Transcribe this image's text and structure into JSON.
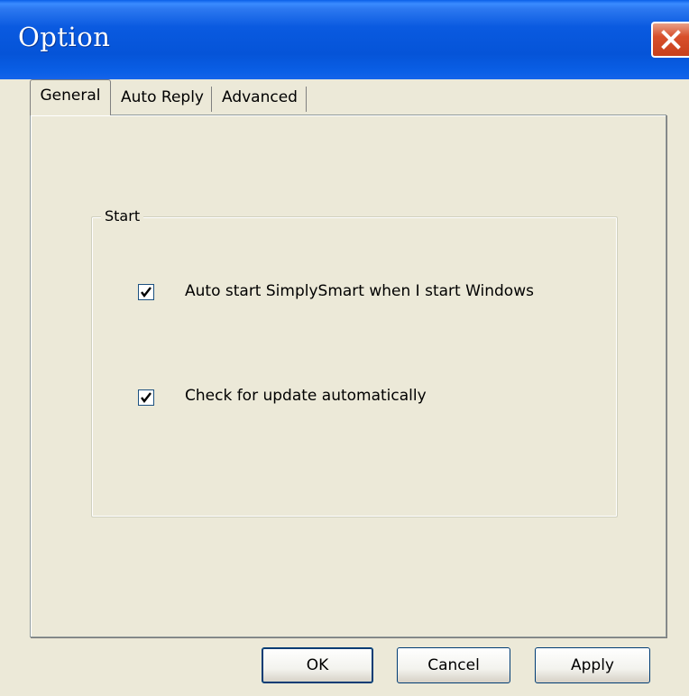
{
  "window": {
    "title": "Option",
    "close_icon": "close-icon"
  },
  "tabs": [
    {
      "label": "General",
      "selected": true
    },
    {
      "label": "Auto Reply",
      "selected": false
    },
    {
      "label": "Advanced",
      "selected": false
    }
  ],
  "group": {
    "label": "Start",
    "options": [
      {
        "label": "Auto start SimplySmart when I start Windows",
        "checked": true
      },
      {
        "label": "Check for update automatically",
        "checked": true
      }
    ]
  },
  "buttons": {
    "ok": "OK",
    "cancel": "Cancel",
    "apply": "Apply"
  },
  "colors": {
    "titlebar": "#0a5ae0",
    "close": "#d8502c",
    "face": "#ece9d8"
  }
}
